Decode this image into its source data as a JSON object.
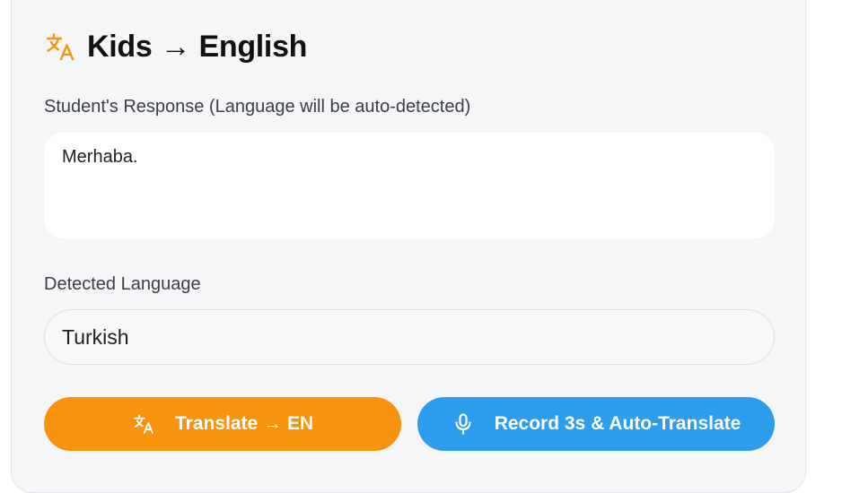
{
  "header": {
    "title": "Kids → English",
    "icon": "translate-icon",
    "icon_color": "#f7930d"
  },
  "response": {
    "label": "Student's Response (Language will be auto-detected)",
    "value": "Merhaba."
  },
  "detected": {
    "label": "Detected Language",
    "value": "Turkish"
  },
  "buttons": {
    "translate_label": "Translate → EN",
    "translate_icon": "translate-icon",
    "translate_color": "#f7930d",
    "record_label": "Record 3s & Auto-Translate",
    "record_icon": "microphone-icon",
    "record_color": "#2f9ded"
  }
}
